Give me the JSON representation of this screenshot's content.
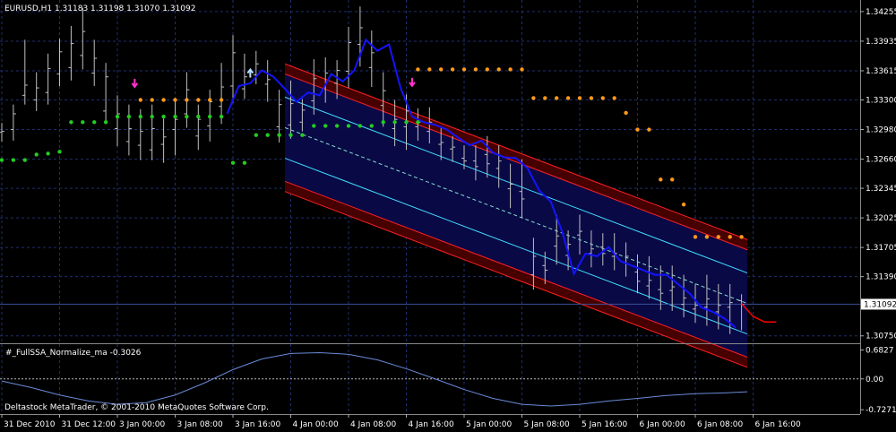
{
  "header": {
    "main": "EURUSD,H1  1.31183 1.31198 1.31070 1.31092",
    "indicator": "#_FullSSA_Normalize_ma -0.3026",
    "footer": "Deltastock MetaTrader, © 2001-2010 MetaQuotes Software Corp."
  },
  "colors": {
    "background": "#000000",
    "grid": "#1e2f6e",
    "bar": "#c0c0c0",
    "ssa_line": "#1414ff",
    "channel_band": "#0a0a4a",
    "channel_outer": "#4a0000",
    "channel_red": "#ff2020",
    "channel_cyan": "#40e0ff",
    "dot_green": "#22cc22",
    "dot_orange": "#ff9a1a",
    "arrow_down": "#ff33cc",
    "arrow_up": "#bbddff",
    "forecast": "#ff0000",
    "oscillator": "#6a8ad8"
  },
  "chart_data": [
    {
      "type": "line",
      "title": "EURUSD,H1",
      "ohlc": {
        "open": 1.31183,
        "high": 1.31198,
        "low": 1.3107,
        "close": 1.31092
      },
      "current_price": "1.31092",
      "y_ticks": [
        "1.34255",
        "1.33935",
        "1.33615",
        "1.33300",
        "1.32980",
        "1.32660",
        "1.32345",
        "1.32025",
        "1.31705",
        "1.31390",
        "1.30750"
      ],
      "x_ticks": [
        "31 Dec 2010",
        "31 Dec 12:00",
        "3 Jan 00:00",
        "3 Jan 08:00",
        "3 Jan 16:00",
        "4 Jan 00:00",
        "4 Jan 08:00",
        "4 Jan 16:00",
        "5 Jan 00:00",
        "5 Jan 08:00",
        "5 Jan 16:00",
        "6 Jan 00:00",
        "6 Jan 08:00",
        "6 Jan 16:00"
      ],
      "ylim": [
        1.3067,
        1.3438
      ],
      "x_range": [
        0,
        129
      ],
      "x_tick_bars": [
        0,
        10,
        20,
        30,
        40,
        50,
        60,
        70,
        80,
        90,
        100,
        110,
        120,
        130
      ],
      "bars": {
        "x": [
          0,
          2,
          4,
          6,
          8,
          10,
          12,
          14,
          16,
          18,
          20,
          22,
          24,
          26,
          28,
          30,
          32,
          34,
          36,
          38,
          40,
          42,
          44,
          46,
          48,
          50,
          52,
          54,
          56,
          58,
          60,
          62,
          64,
          66,
          68,
          70,
          72,
          74,
          76,
          78,
          80,
          82,
          84,
          86,
          88,
          90,
          92,
          94,
          96,
          98,
          100,
          102,
          104,
          106,
          108,
          110,
          112,
          114,
          116,
          118,
          120,
          122,
          124,
          126,
          128
        ],
        "high": [
          1.3305,
          1.3325,
          1.3395,
          1.336,
          1.338,
          1.3396,
          1.341,
          1.343,
          1.3395,
          1.337,
          1.3335,
          1.3325,
          1.332,
          1.3325,
          1.331,
          1.3332,
          1.336,
          1.3325,
          1.3341,
          1.337,
          1.34,
          1.338,
          1.3383,
          1.3373,
          1.3341,
          1.3351,
          1.3331,
          1.3374,
          1.3376,
          1.3373,
          1.3409,
          1.3431,
          1.3405,
          1.336,
          1.333,
          1.3336,
          1.3321,
          1.3322,
          1.3301,
          1.3291,
          1.3281,
          1.3281,
          1.3291,
          1.3281,
          1.3261,
          1.3266,
          1.3181,
          1.3166,
          1.3206,
          1.3189,
          1.3206,
          1.3189,
          1.3186,
          1.3186,
          1.3176,
          1.3163,
          1.3161,
          1.3151,
          1.3151,
          1.3141,
          1.3131,
          1.3141,
          1.3131,
          1.3131,
          1.312
        ],
        "low": [
          1.3285,
          1.3286,
          1.3325,
          1.3318,
          1.3325,
          1.3345,
          1.3351,
          1.3363,
          1.3345,
          1.3305,
          1.328,
          1.327,
          1.3265,
          1.3265,
          1.3262,
          1.327,
          1.33,
          1.3276,
          1.3285,
          1.3304,
          1.3327,
          1.3331,
          1.3347,
          1.3328,
          1.3284,
          1.3288,
          1.3296,
          1.3314,
          1.3327,
          1.3331,
          1.3343,
          1.3366,
          1.3344,
          1.3301,
          1.328,
          1.3276,
          1.3286,
          1.3283,
          1.3265,
          1.3263,
          1.3255,
          1.3243,
          1.3246,
          1.3235,
          1.3213,
          1.3202,
          1.3125,
          1.3131,
          1.3152,
          1.3146,
          1.3163,
          1.3149,
          1.3151,
          1.3146,
          1.3139,
          1.3121,
          1.3115,
          1.3103,
          1.3102,
          1.3095,
          1.3089,
          1.3086,
          1.3082,
          1.3077,
          1.3081
        ],
        "open": [
          1.3295,
          1.3298,
          1.3335,
          1.333,
          1.3338,
          1.3358,
          1.3365,
          1.3378,
          1.3359,
          1.3318,
          1.3299,
          1.3285,
          1.3281,
          1.3276,
          1.3282,
          1.3298,
          1.3315,
          1.3291,
          1.3302,
          1.3323,
          1.3345,
          1.3342,
          1.3357,
          1.3347,
          1.3301,
          1.3303,
          1.3306,
          1.3329,
          1.3343,
          1.3348,
          1.3361,
          1.339,
          1.3365,
          1.3324,
          1.3299,
          1.3301,
          1.3301,
          1.3296,
          1.3282,
          1.3277,
          1.3267,
          1.3264,
          1.3271,
          1.3256,
          1.3234,
          1.3231,
          1.3141,
          1.3151,
          1.3172,
          1.3162,
          1.3184,
          1.3164,
          1.3171,
          1.3161,
          1.3154,
          1.3144,
          1.3129,
          1.3125,
          1.3124,
          1.3109,
          1.3104,
          1.3106,
          1.3101,
          1.3106,
          1.3113
        ],
        "close": [
          1.3296,
          1.3315,
          1.3346,
          1.3343,
          1.3364,
          1.3382,
          1.3391,
          1.3404,
          1.3375,
          1.3355,
          1.3315,
          1.3299,
          1.3296,
          1.3299,
          1.329,
          1.3309,
          1.3341,
          1.3309,
          1.3328,
          1.3344,
          1.3381,
          1.3355,
          1.3369,
          1.3352,
          1.3325,
          1.3326,
          1.3319,
          1.3353,
          1.3359,
          1.3362,
          1.3392,
          1.3408,
          1.3381,
          1.334,
          1.3309,
          1.3318,
          1.3306,
          1.3306,
          1.3284,
          1.3279,
          1.3264,
          1.3258,
          1.3261,
          1.3264,
          1.3239,
          1.3223,
          1.3161,
          1.3146,
          1.3183,
          1.3174,
          1.3188,
          1.3169,
          1.3164,
          1.3164,
          1.3161,
          1.3134,
          1.3135,
          1.3121,
          1.3128,
          1.3116,
          1.3108,
          1.3115,
          1.3108,
          1.3111,
          1.3109
        ]
      },
      "series": [
        {
          "values_x": [
            39,
            41,
            43,
            45,
            47,
            49,
            51,
            53,
            55,
            57,
            59,
            61,
            63,
            65,
            67,
            69,
            71,
            73,
            75,
            77,
            79,
            81,
            83,
            85,
            87,
            89,
            91,
            93,
            95,
            97,
            99,
            101,
            103,
            105,
            107,
            109,
            111,
            113,
            115,
            117,
            119,
            121,
            123,
            125,
            127
          ],
          "values": [
            1.3315,
            1.3345,
            1.3348,
            1.3362,
            1.3355,
            1.3342,
            1.3328,
            1.3338,
            1.3335,
            1.3358,
            1.335,
            1.3362,
            1.3395,
            1.3383,
            1.339,
            1.3343,
            1.3312,
            1.3306,
            1.3303,
            1.3298,
            1.3289,
            1.3281,
            1.3286,
            1.3273,
            1.3268,
            1.3267,
            1.3256,
            1.3232,
            1.322,
            1.3187,
            1.3142,
            1.3164,
            1.3161,
            1.3171,
            1.3156,
            1.3151,
            1.3146,
            1.3141,
            1.3141,
            1.3131,
            1.3121,
            1.3106,
            1.3101,
            1.3094,
            1.3084
          ]
        },
        {
          "values_x": [
            128,
            130,
            132,
            134
          ],
          "values": [
            1.311,
            1.3096,
            1.309,
            1.309
          ]
        }
      ],
      "dots_green": {
        "x": [
          0,
          2,
          4,
          6,
          8,
          10,
          12,
          14,
          16,
          18,
          20,
          22,
          24,
          26,
          28,
          30,
          32,
          34,
          36,
          38,
          40,
          42,
          44,
          46,
          48,
          50,
          52,
          54,
          56,
          58,
          60,
          62,
          64,
          66,
          68,
          70,
          72
        ],
        "y": [
          1.3265,
          1.3265,
          1.3265,
          1.3271,
          1.3272,
          1.3274,
          1.3306,
          1.3306,
          1.3306,
          1.3306,
          1.3312,
          1.3312,
          1.3312,
          1.3312,
          1.3312,
          1.3312,
          1.3312,
          1.3312,
          1.3312,
          1.3312,
          1.3262,
          1.3262,
          1.3292,
          1.3292,
          1.3292,
          1.3292,
          1.3292,
          1.3302,
          1.3302,
          1.3302,
          1.3302,
          1.3302,
          1.3302,
          1.3306,
          1.3306,
          1.3306,
          1.3306
        ]
      },
      "dots_orange": {
        "x": [
          24,
          26,
          28,
          30,
          32,
          34,
          36,
          38,
          72,
          74,
          76,
          78,
          80,
          82,
          84,
          86,
          88,
          90,
          92,
          94,
          96,
          98,
          100,
          102,
          104,
          106,
          108,
          110,
          112,
          114,
          116,
          118,
          120,
          122,
          124,
          126,
          128
        ],
        "y": [
          1.333,
          1.333,
          1.333,
          1.333,
          1.333,
          1.333,
          1.333,
          1.333,
          1.3363,
          1.3363,
          1.3363,
          1.3363,
          1.3363,
          1.3363,
          1.3363,
          1.3363,
          1.3363,
          1.3363,
          1.3332,
          1.3332,
          1.3332,
          1.3332,
          1.3332,
          1.3332,
          1.3332,
          1.3332,
          1.3316,
          1.3298,
          1.3298,
          1.3244,
          1.3244,
          1.3217,
          1.3182,
          1.3182,
          1.3182,
          1.3182,
          1.3182
        ]
      },
      "arrows": [
        {
          "x": 23,
          "y": 1.3348,
          "dir": "down"
        },
        {
          "x": 43,
          "y": 1.3359,
          "dir": "up"
        },
        {
          "x": 71,
          "y": 1.3349,
          "dir": "down"
        }
      ],
      "channel": {
        "start_x": 49,
        "end_x": 129,
        "start_center": 1.33,
        "end_center": 1.311,
        "inner_offset": 0.0033,
        "outer_offset": 0.0058,
        "outer_edge": 0.0069
      },
      "hline": 1.31092
    },
    {
      "type": "line",
      "title": "#_FullSSA_Normalize_ma -0.3026",
      "y_ticks": [
        "0.6827",
        "0.00",
        "-0.7271"
      ],
      "ylim": [
        -0.83,
        0.82
      ],
      "zero_line": 0,
      "x": [
        0,
        5,
        10,
        15,
        20,
        25,
        30,
        35,
        40,
        45,
        50,
        55,
        60,
        65,
        70,
        75,
        80,
        85,
        90,
        95,
        100,
        105,
        110,
        115,
        120,
        125,
        129
      ],
      "values": [
        -0.05,
        -0.2,
        -0.38,
        -0.52,
        -0.6,
        -0.56,
        -0.38,
        -0.1,
        0.22,
        0.47,
        0.6,
        0.62,
        0.58,
        0.45,
        0.24,
        0.0,
        -0.25,
        -0.46,
        -0.6,
        -0.64,
        -0.6,
        -0.52,
        -0.46,
        -0.39,
        -0.35,
        -0.33,
        -0.3026
      ]
    }
  ]
}
